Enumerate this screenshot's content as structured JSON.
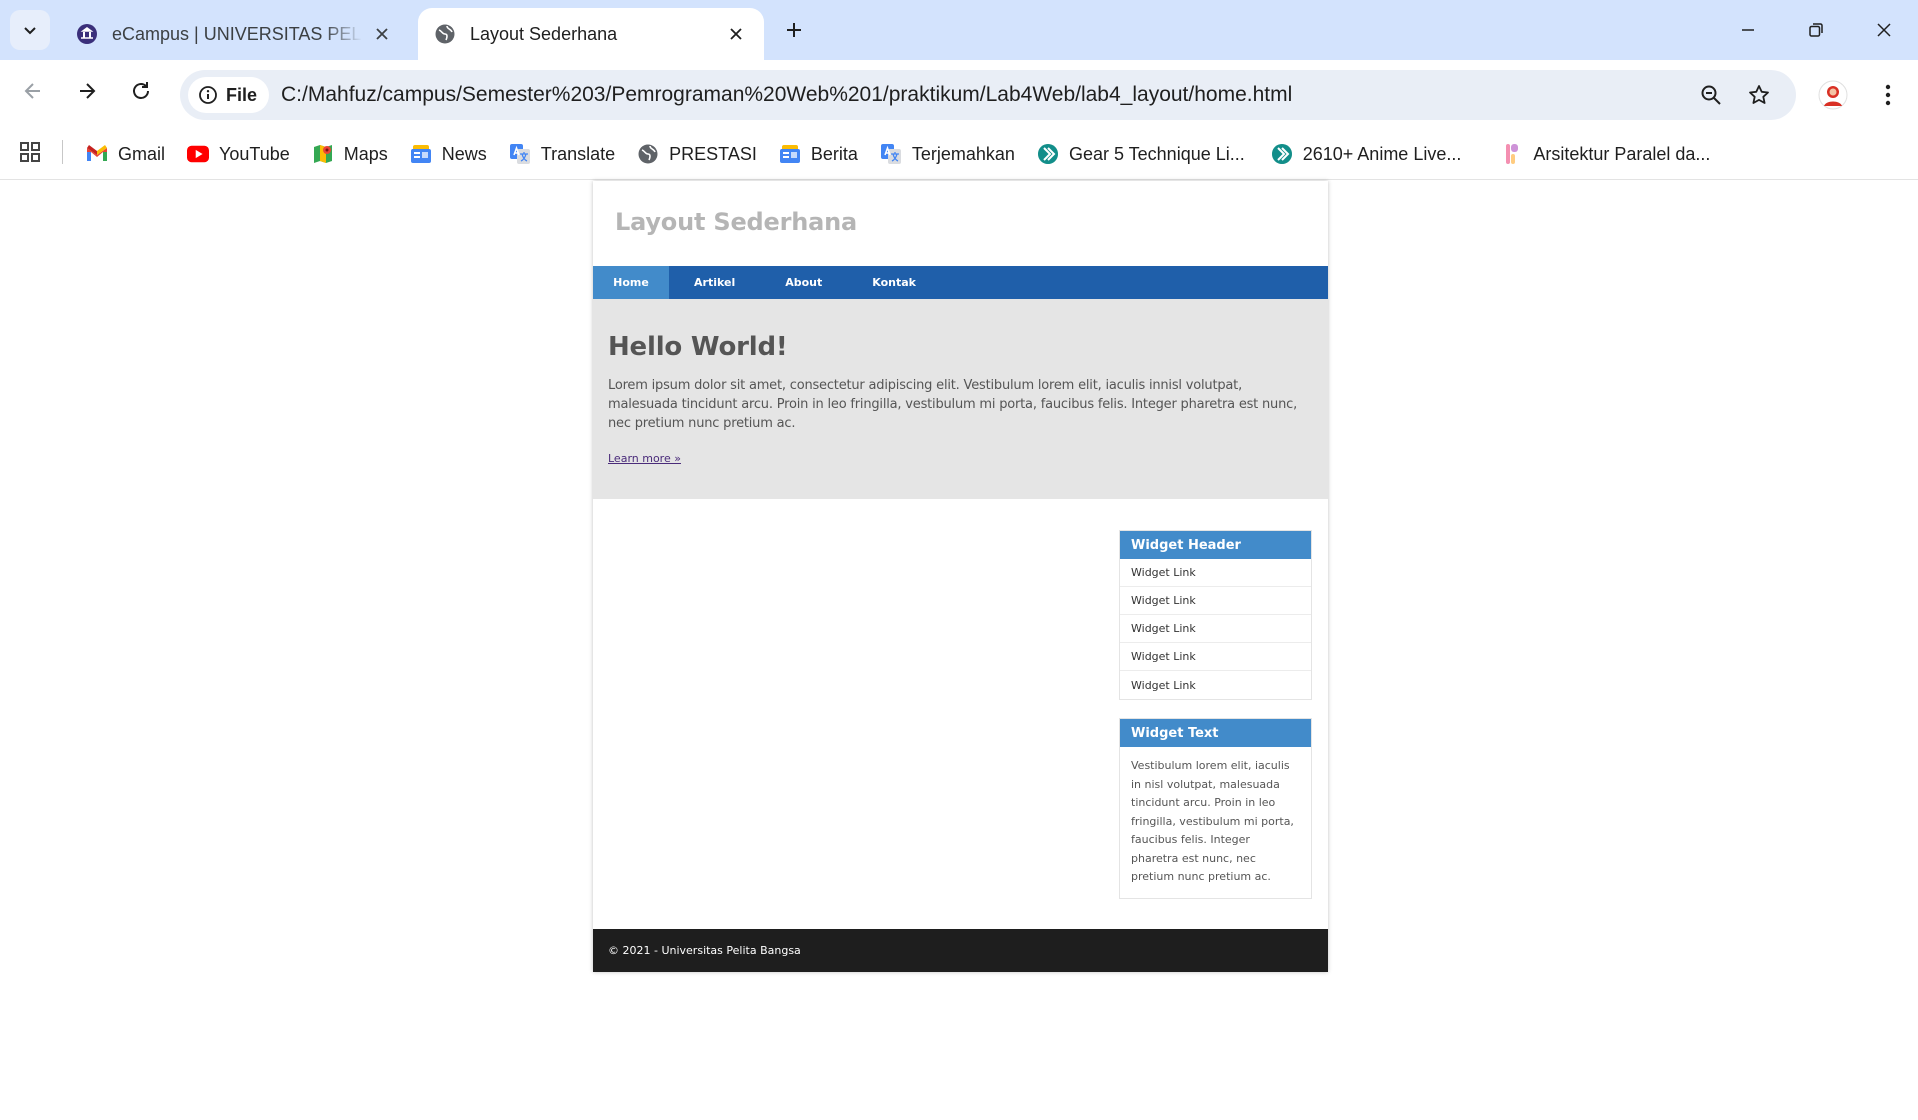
{
  "browser": {
    "tabs": [
      {
        "title": "eCampus | UNIVERSITAS PELITA BANGSA",
        "active": false,
        "favicon": "university-logo-icon"
      },
      {
        "title": "Layout Sederhana",
        "active": true,
        "favicon": "globe-icon"
      }
    ],
    "address": {
      "scheme_label": "File",
      "url": "C:/Mahfuz/campus/Semester%203/Pemrograman%20Web%201/praktikum/Lab4Web/lab4_layout/home.html"
    },
    "bookmarks": [
      {
        "label": "Gmail",
        "icon": "gmail-icon"
      },
      {
        "label": "YouTube",
        "icon": "youtube-icon"
      },
      {
        "label": "Maps",
        "icon": "maps-icon"
      },
      {
        "label": "News",
        "icon": "news-icon"
      },
      {
        "label": "Translate",
        "icon": "translate-icon"
      },
      {
        "label": "PRESTASI",
        "icon": "globe-icon"
      },
      {
        "label": "Berita",
        "icon": "news-icon"
      },
      {
        "label": "Terjemahkan",
        "icon": "translate-icon"
      },
      {
        "label": "Gear 5 Technique Li...",
        "icon": "play-arrow-icon"
      },
      {
        "label": "2610+ Anime Live...",
        "icon": "play-arrow-icon"
      },
      {
        "label": "Arsitektur Paralel da...",
        "icon": "document-icon"
      }
    ]
  },
  "page": {
    "site_title": "Layout Sederhana",
    "nav": [
      "Home",
      "Artikel",
      "About",
      "Kontak"
    ],
    "hero": {
      "heading": "Hello World!",
      "paragraph": "Lorem ipsum dolor sit amet, consectetur adipiscing elit. Vestibulum lorem elit, iaculis innisl volutpat, malesuada tincidunt arcu. Proin in leo fringilla, vestibulum mi porta, faucibus felis. Integer pharetra est nunc, nec pretium nunc pretium ac.",
      "link": "Learn more »"
    },
    "widget_links": {
      "header": "Widget Header",
      "links": [
        "Widget Link",
        "Widget Link",
        "Widget Link",
        "Widget Link",
        "Widget Link"
      ]
    },
    "widget_text": {
      "header": "Widget Text",
      "body": "Vestibulum lorem elit, iaculis in nisl volutpat, malesuada tincidunt arcu. Proin in leo fringilla, vestibulum mi porta, faucibus felis. Integer pharetra est nunc, nec pretium nunc pretium ac."
    },
    "footer": "© 2021 - Universitas Pelita Bangsa"
  },
  "colors": {
    "tabstrip": "#d3e3fd",
    "nav_bar": "#1f5faa",
    "nav_active": "#428bca",
    "widget_header": "#428bca",
    "hero_bg": "#e5e5e5",
    "footer_bg": "#1e1e1e"
  }
}
